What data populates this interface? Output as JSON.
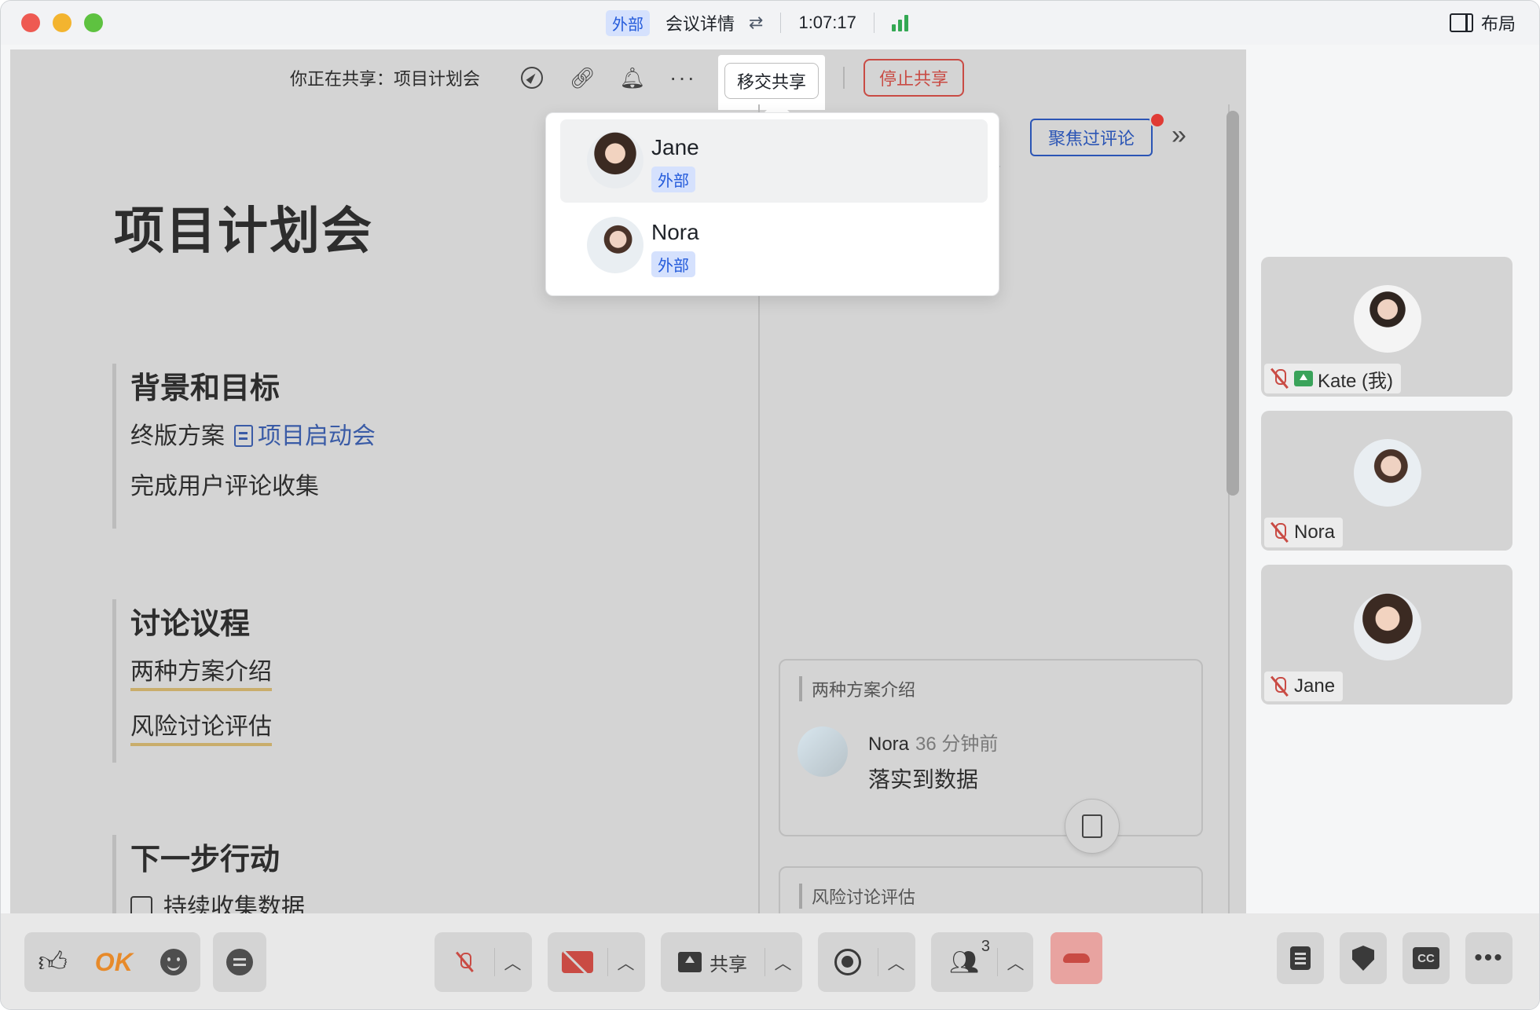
{
  "titlebar": {
    "external_badge": "外部",
    "meeting_details": "会议详情",
    "timer": "1:07:17",
    "layout_label": "布局"
  },
  "sharebar": {
    "sharing_text": "你正在共享：项目计划会",
    "handover_label": "移交共享",
    "stop_label": "停止共享"
  },
  "document": {
    "title": "项目计划会",
    "sections": [
      {
        "heading": "背景和目标",
        "line1_text": "终版方案",
        "line1_link": "项目启动会",
        "line2": "完成用户评论收集"
      },
      {
        "heading": "讨论议程",
        "items": [
          "两种方案介绍",
          "风险讨论评估"
        ]
      },
      {
        "heading": "下一步行动",
        "todo": "持续收集数据"
      }
    ]
  },
  "comments_panel": {
    "focus_label": "聚焦过评论",
    "cards": [
      {
        "quote": "两种方案介绍",
        "author": "Nora",
        "time": "36 分钟前",
        "body": "落实到数据"
      },
      {
        "quote": "风险讨论评估"
      }
    ]
  },
  "handover_dropdown": {
    "items": [
      {
        "name": "Jane",
        "badge": "外部",
        "highlighted": true
      },
      {
        "name": "Nora",
        "badge": "外部",
        "highlighted": false
      }
    ]
  },
  "participants": [
    {
      "name": "Kate (我)",
      "muted": true,
      "sharing": true
    },
    {
      "name": "Nora",
      "muted": true,
      "sharing": false
    },
    {
      "name": "Jane",
      "muted": true,
      "sharing": false
    }
  ],
  "toolbar": {
    "ok_reaction": "OK",
    "share_label": "共享",
    "participant_count": "3"
  },
  "colors": {
    "accent_blue": "#245bdb",
    "danger_red": "#c94b44",
    "signal_green": "#34a853"
  }
}
